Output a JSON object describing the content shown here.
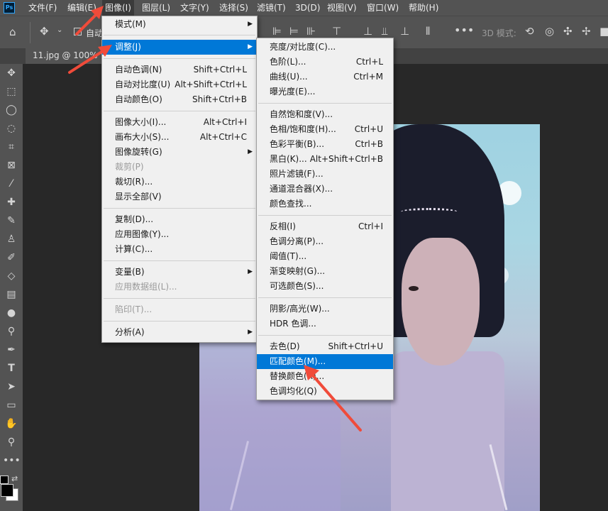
{
  "menubar": {
    "logo": "Ps",
    "items": [
      "文件(F)",
      "编辑(E)",
      "图像(I)",
      "图层(L)",
      "文字(Y)",
      "选择(S)",
      "滤镜(T)",
      "3D(D)",
      "视图(V)",
      "窗口(W)",
      "帮助(H)"
    ],
    "active_index": 2
  },
  "options_bar": {
    "auto_select_label": "自动",
    "mode_3d_label": "3D 模式:"
  },
  "document_tab": {
    "title": "11.jpg @ 100%"
  },
  "image_menu": {
    "items": [
      {
        "label": "模式(M)",
        "shortcut": "",
        "submenu": true
      },
      {
        "label": "调整(J)",
        "shortcut": "",
        "submenu": true,
        "highlighted": true
      },
      {
        "label": "自动色调(N)",
        "shortcut": "Shift+Ctrl+L"
      },
      {
        "label": "自动对比度(U)",
        "shortcut": "Alt+Shift+Ctrl+L"
      },
      {
        "label": "自动颜色(O)",
        "shortcut": "Shift+Ctrl+B"
      },
      {
        "label": "图像大小(I)...",
        "shortcut": "Alt+Ctrl+I"
      },
      {
        "label": "画布大小(S)...",
        "shortcut": "Alt+Ctrl+C"
      },
      {
        "label": "图像旋转(G)",
        "shortcut": "",
        "submenu": true
      },
      {
        "label": "裁剪(P)",
        "shortcut": "",
        "disabled": true
      },
      {
        "label": "裁切(R)...",
        "shortcut": ""
      },
      {
        "label": "显示全部(V)",
        "shortcut": ""
      },
      {
        "label": "复制(D)...",
        "shortcut": ""
      },
      {
        "label": "应用图像(Y)...",
        "shortcut": ""
      },
      {
        "label": "计算(C)...",
        "shortcut": ""
      },
      {
        "label": "变量(B)",
        "shortcut": "",
        "submenu": true
      },
      {
        "label": "应用数据组(L)...",
        "shortcut": "",
        "disabled": true
      },
      {
        "label": "陷印(T)...",
        "shortcut": "",
        "disabled": true
      },
      {
        "label": "分析(A)",
        "shortcut": "",
        "submenu": true
      }
    ]
  },
  "adjust_menu": {
    "items": [
      {
        "label": "亮度/对比度(C)...",
        "shortcut": ""
      },
      {
        "label": "色阶(L)...",
        "shortcut": "Ctrl+L"
      },
      {
        "label": "曲线(U)...",
        "shortcut": "Ctrl+M"
      },
      {
        "label": "曝光度(E)...",
        "shortcut": ""
      },
      {
        "label": "自然饱和度(V)...",
        "shortcut": ""
      },
      {
        "label": "色相/饱和度(H)...",
        "shortcut": "Ctrl+U"
      },
      {
        "label": "色彩平衡(B)...",
        "shortcut": "Ctrl+B"
      },
      {
        "label": "黑白(K)...",
        "shortcut": "Alt+Shift+Ctrl+B"
      },
      {
        "label": "照片滤镜(F)...",
        "shortcut": ""
      },
      {
        "label": "通道混合器(X)...",
        "shortcut": ""
      },
      {
        "label": "颜色查找...",
        "shortcut": ""
      },
      {
        "label": "反相(I)",
        "shortcut": "Ctrl+I"
      },
      {
        "label": "色调分离(P)...",
        "shortcut": ""
      },
      {
        "label": "阈值(T)...",
        "shortcut": ""
      },
      {
        "label": "渐变映射(G)...",
        "shortcut": ""
      },
      {
        "label": "可选颜色(S)...",
        "shortcut": ""
      },
      {
        "label": "阴影/高光(W)...",
        "shortcut": ""
      },
      {
        "label": "HDR 色调...",
        "shortcut": ""
      },
      {
        "label": "去色(D)",
        "shortcut": "Shift+Ctrl+U"
      },
      {
        "label": "匹配颜色(M)...",
        "shortcut": "",
        "highlighted": true
      },
      {
        "label": "替换颜色(R)...",
        "shortcut": ""
      },
      {
        "label": "色调均化(Q)",
        "shortcut": ""
      }
    ]
  },
  "colors": {
    "menu_highlight": "#0078d7",
    "annotation_arrow": "#f04b3a",
    "menubar_bg": "#535353"
  }
}
